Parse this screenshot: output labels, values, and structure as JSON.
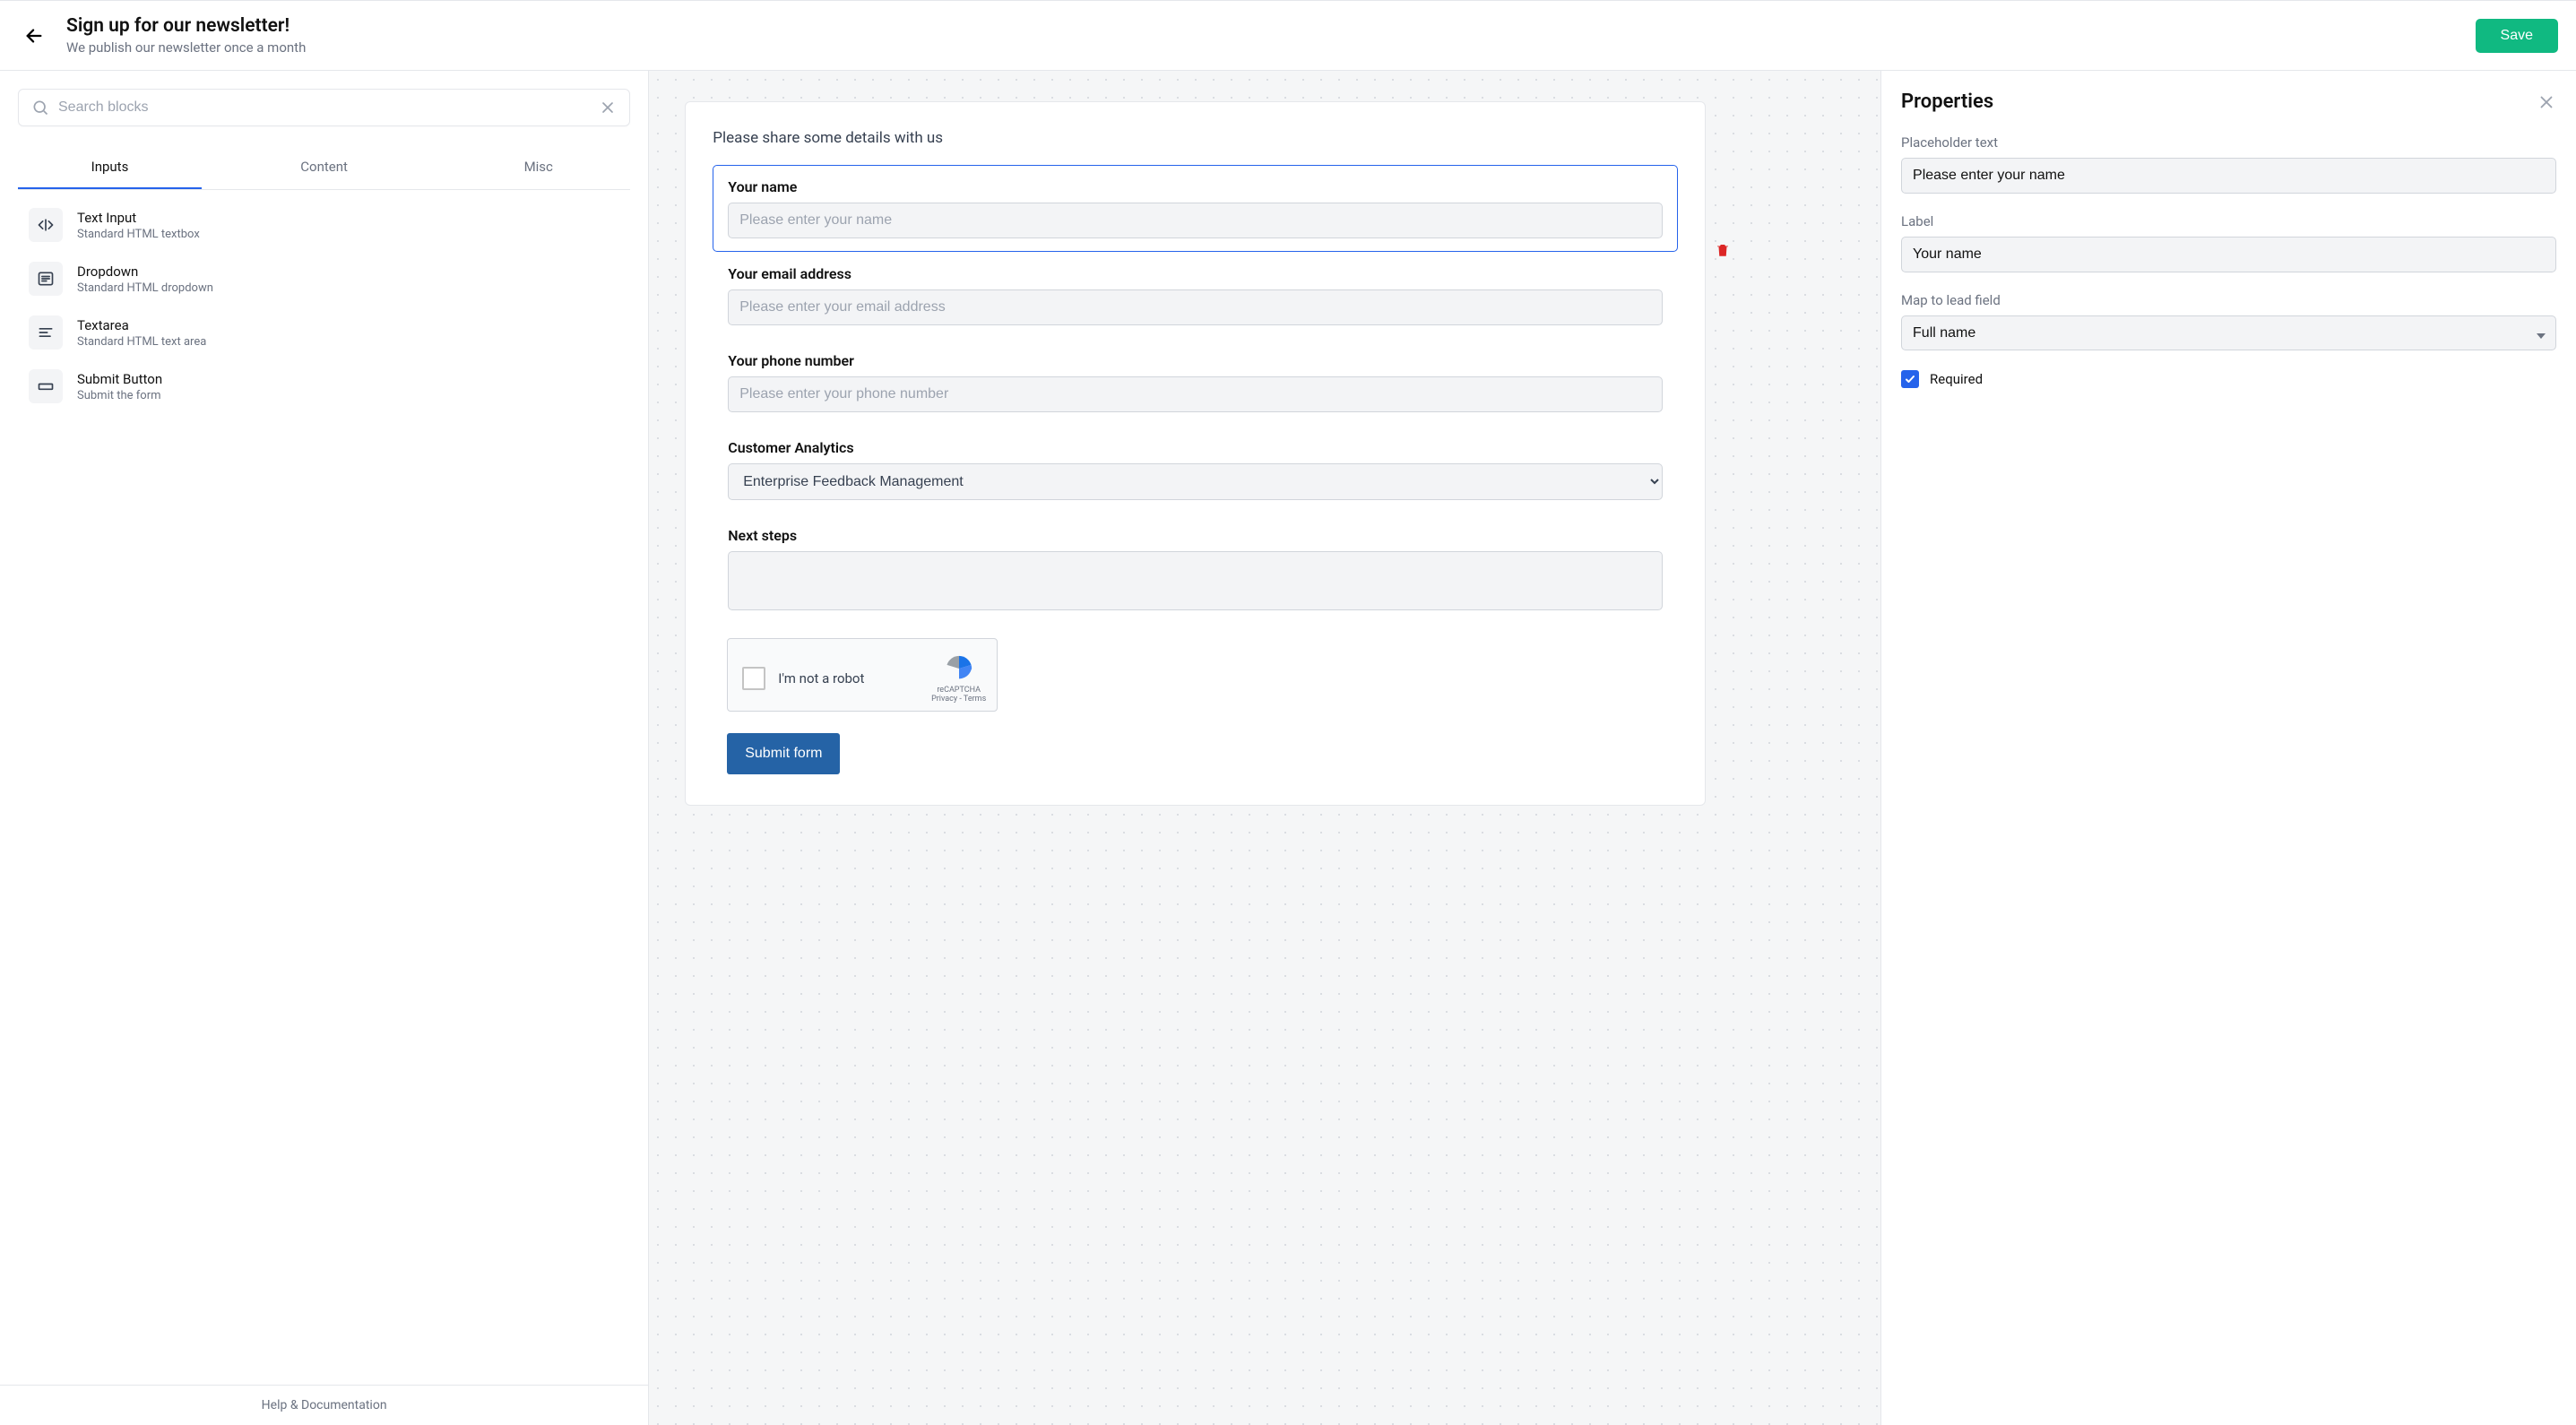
{
  "header": {
    "title": "Sign up for our newsletter!",
    "subtitle": "We publish our newsletter once a month",
    "save_label": "Save"
  },
  "sidebar": {
    "search_placeholder": "Search blocks",
    "tabs": [
      "Inputs",
      "Content",
      "Misc"
    ],
    "active_tab_index": 0,
    "blocks": [
      {
        "icon": "code",
        "title": "Text Input",
        "desc": "Standard HTML textbox"
      },
      {
        "icon": "list",
        "title": "Dropdown",
        "desc": "Standard HTML dropdown"
      },
      {
        "icon": "lines",
        "title": "Textarea",
        "desc": "Standard HTML text area"
      },
      {
        "icon": "button",
        "title": "Submit Button",
        "desc": "Submit the form"
      }
    ],
    "footer": "Help & Documentation"
  },
  "form": {
    "heading": "Please share some details with us",
    "fields": [
      {
        "type": "text",
        "label": "Your name",
        "placeholder": "Please enter your name",
        "selected": true
      },
      {
        "type": "text",
        "label": "Your email address",
        "placeholder": "Please enter your email address",
        "selected": false
      },
      {
        "type": "text",
        "label": "Your phone number",
        "placeholder": "Please enter your phone number",
        "selected": false
      },
      {
        "type": "select",
        "label": "Customer Analytics",
        "value": "Enterprise Feedback Management",
        "selected": false
      },
      {
        "type": "textarea",
        "label": "Next steps",
        "value": "",
        "selected": false
      }
    ],
    "recaptcha": {
      "label": "I'm not a robot",
      "brand": "reCAPTCHA",
      "legal": "Privacy - Terms"
    },
    "submit_label": "Submit form"
  },
  "properties": {
    "title": "Properties",
    "placeholder_label": "Placeholder text",
    "placeholder_value": "Please enter your name",
    "label_label": "Label",
    "label_value": "Your name",
    "map_label": "Map to lead field",
    "map_value": "Full name",
    "required_label": "Required",
    "required_checked": true
  }
}
